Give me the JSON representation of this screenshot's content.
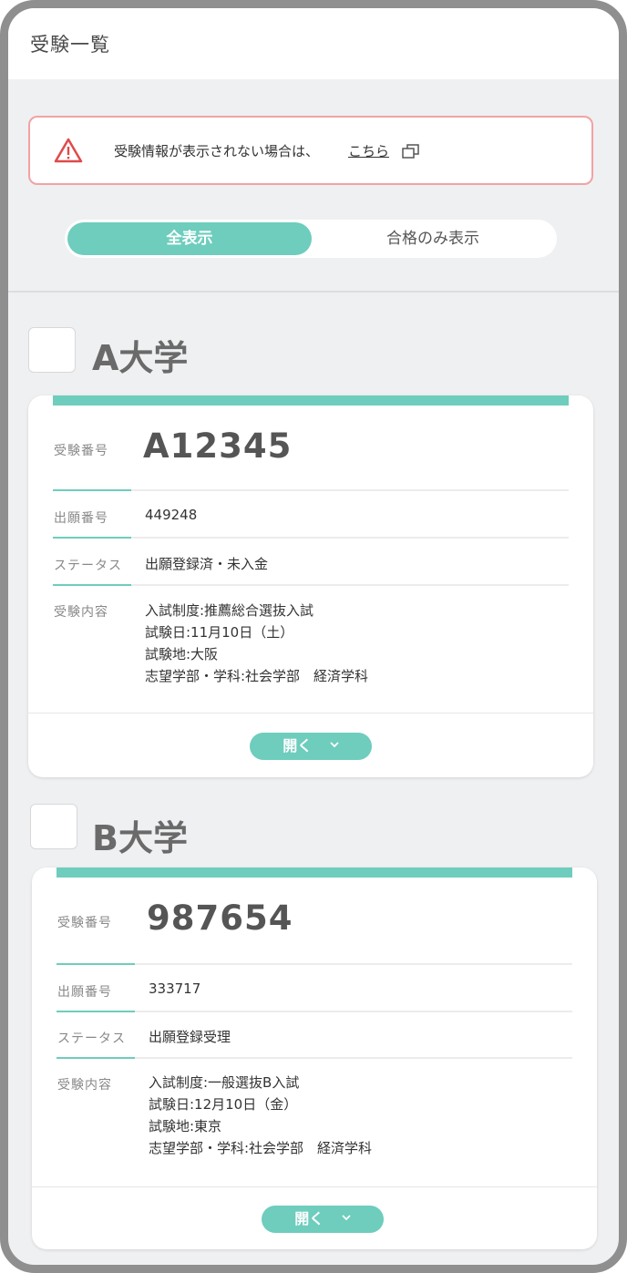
{
  "header": {
    "title": "受験一覧"
  },
  "alert": {
    "message": "受験情報が表示されない場合は、",
    "link_text": "こちら"
  },
  "filter": {
    "all_label": "全表示",
    "passed_label": "合格のみ表示"
  },
  "labels": {
    "exam_number": "受験番号",
    "application_number": "出願番号",
    "status": "ステータス",
    "exam_details": "受験内容",
    "open_button": "開く"
  },
  "universities": [
    {
      "name": "A大学",
      "exam_number": "A12345",
      "application_number": "449248",
      "status": "出願登録済・未入金",
      "details": [
        "入試制度:推薦総合選抜入試",
        "試験日:11月10日（土）",
        "試験地:大阪",
        "志望学部・学科:社会学部　経済学科"
      ]
    },
    {
      "name": "B大学",
      "exam_number": "987654",
      "application_number": "333717",
      "status": "出願登録受理",
      "details": [
        "入試制度:一般選抜B入試",
        "試験日:12月10日（金）",
        "試験地:東京",
        "志望学部・学科:社会学部　経済学科"
      ]
    }
  ],
  "colors": {
    "accent": "#6ecdbd",
    "alert_border": "#f0a3a3",
    "alert_icon": "#e04a4a"
  },
  "icons": {
    "alert": "warning-triangle-icon",
    "link": "external-window-icon",
    "expand": "chevron-down-icon"
  }
}
